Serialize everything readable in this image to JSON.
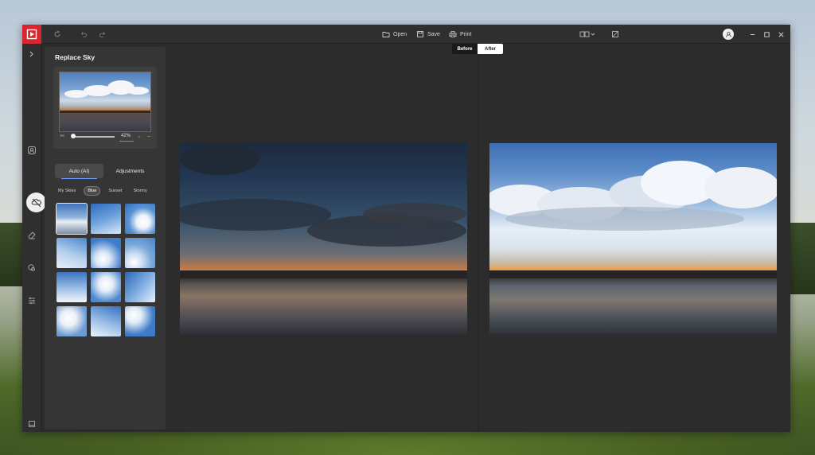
{
  "window": {
    "brand_color": "#d7262d",
    "toolbar": {
      "open_label": "Open",
      "save_label": "Save",
      "print_label": "Print"
    }
  },
  "panel": {
    "title": "Replace Sky",
    "zoom_value": "42%",
    "tabs": [
      {
        "label": "Auto (AI)",
        "active": true
      },
      {
        "label": "Adjustments",
        "active": false
      }
    ],
    "categories": [
      {
        "label": "My Skies",
        "active": false
      },
      {
        "label": "Blue",
        "active": true
      },
      {
        "label": "Sunset",
        "active": false
      },
      {
        "label": "Stormy",
        "active": false
      }
    ],
    "thumbnails_count": 12
  },
  "compare": {
    "before_label": "Before",
    "after_label": "After"
  },
  "icons": {
    "refresh": "refresh-icon",
    "undo": "undo-icon",
    "redo": "redo-icon",
    "open": "folder-open-icon",
    "save": "save-icon",
    "print": "printer-icon",
    "compare": "compare-view-icon",
    "crop": "crop-icon",
    "account": "user-avatar-icon",
    "minimize": "minimize-icon",
    "maximize": "maximize-icon",
    "close": "close-icon"
  }
}
